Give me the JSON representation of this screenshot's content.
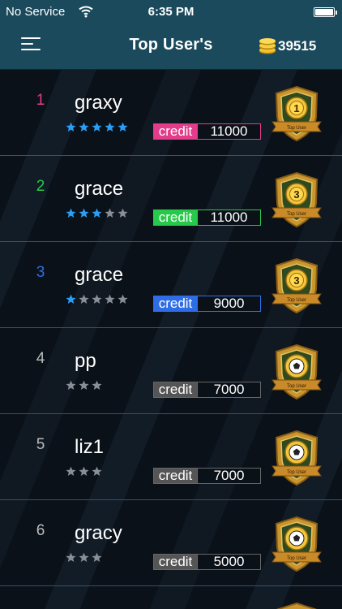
{
  "status_bar": {
    "carrier": "No Service",
    "time": "6:35 PM"
  },
  "navbar": {
    "title": "Top User's",
    "coin_count": "39515",
    "menu_icon": "hamburger-menu-icon",
    "coin_icon": "coin-stack-icon"
  },
  "colors": {
    "header": "#1a4a5c",
    "rank1": "#e23c8a",
    "rank2": "#27c94a",
    "rank3": "#2f6de6",
    "other": "#555555",
    "star_active": "#2a9df4",
    "star_inactive": "#8a8f96"
  },
  "users": [
    {
      "rank": "1",
      "name": "graxy",
      "stars_active": 5,
      "stars_total": 5,
      "credit_label": "credit",
      "credit": "11000",
      "badge_number": "1",
      "badge_type": "number",
      "badge_caption": "Top User",
      "color": "#e23c8a"
    },
    {
      "rank": "2",
      "name": "grace",
      "stars_active": 3,
      "stars_total": 5,
      "credit_label": "credit",
      "credit": "11000",
      "badge_number": "3",
      "badge_type": "number",
      "badge_caption": "Top User",
      "color": "#27c94a"
    },
    {
      "rank": "3",
      "name": "grace",
      "stars_active": 1,
      "stars_total": 5,
      "credit_label": "credit",
      "credit": "9000",
      "badge_number": "3",
      "badge_type": "number",
      "badge_caption": "Top User",
      "color": "#2f6de6"
    },
    {
      "rank": "4",
      "name": "pp",
      "stars_active": 0,
      "stars_total": 3,
      "credit_label": "credit",
      "credit": "7000",
      "badge_number": "",
      "badge_type": "ball",
      "badge_caption": "Top User",
      "color": "#555555"
    },
    {
      "rank": "5",
      "name": "liz1",
      "stars_active": 0,
      "stars_total": 3,
      "credit_label": "credit",
      "credit": "7000",
      "badge_number": "",
      "badge_type": "ball",
      "badge_caption": "Top User",
      "color": "#555555"
    },
    {
      "rank": "6",
      "name": "gracy",
      "stars_active": 0,
      "stars_total": 3,
      "credit_label": "credit",
      "credit": "5000",
      "badge_number": "",
      "badge_type": "ball",
      "badge_caption": "Top User",
      "color": "#555555"
    }
  ]
}
